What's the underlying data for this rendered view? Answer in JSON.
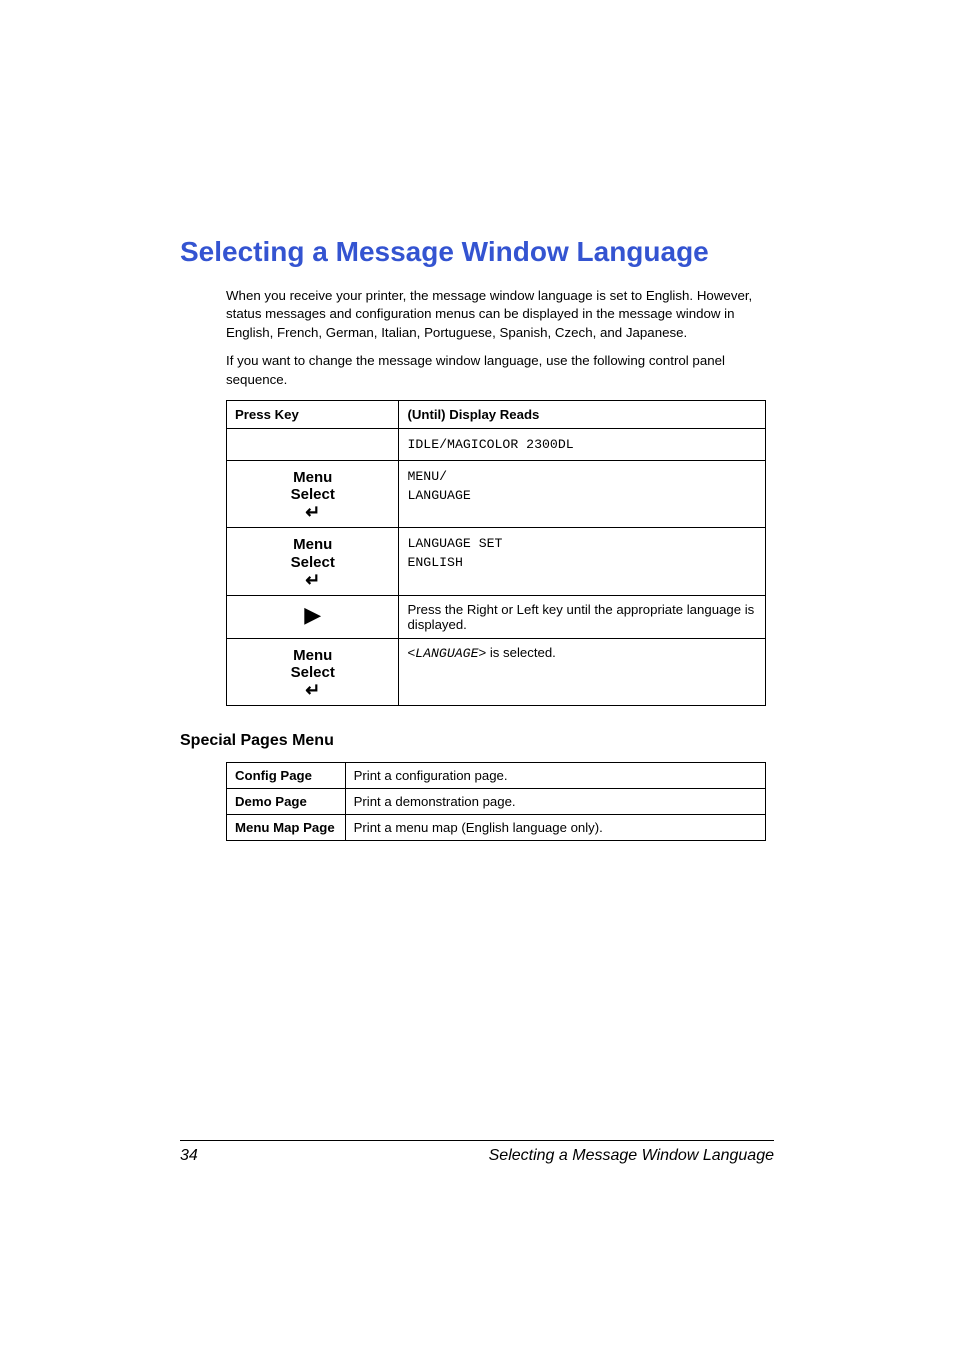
{
  "title": "Selecting a Message Window Language",
  "intro1": "When you receive your printer, the message window language is set to English. However, status messages and configuration menus can be displayed in the message window in English, French, German, Italian, Portuguese, Spanish, Czech, and Japanese.",
  "intro2": "If you want to change the message window language, use the following control panel sequence.",
  "seq": {
    "headers": {
      "key": "Press Key",
      "reads": "(Until) Display Reads"
    },
    "rows": [
      {
        "key_type": "blank",
        "reads_type": "mono",
        "line1": "IDLE/MAGICOLOR 2300DL"
      },
      {
        "key_type": "menu_select",
        "menu": "Menu",
        "select": "Select",
        "reads_type": "mono",
        "line1": "MENU/",
        "line2": "LANGUAGE"
      },
      {
        "key_type": "menu_select",
        "menu": "Menu",
        "select": "Select",
        "reads_type": "mono",
        "line1": "LANGUAGE SET",
        "line2": "ENGLISH"
      },
      {
        "key_type": "right_arrow",
        "reads_type": "text",
        "line1": "Press the Right or Left key until the appropriate language is displayed."
      },
      {
        "key_type": "menu_select",
        "menu": "Menu",
        "select": "Select",
        "reads_type": "lang_selected",
        "prefix": "<",
        "var": "LANGUAGE",
        "suffix": "> is selected."
      }
    ]
  },
  "special_title": "Special Pages Menu",
  "special_rows": [
    {
      "name": "Config Page",
      "desc": "Print a configuration page."
    },
    {
      "name": "Demo Page",
      "desc": "Print a demonstration page."
    },
    {
      "name": "Menu Map Page",
      "desc": "Print a menu map (English language only)."
    }
  ],
  "footer": {
    "page": "34",
    "title": "Selecting a Message Window Language"
  }
}
